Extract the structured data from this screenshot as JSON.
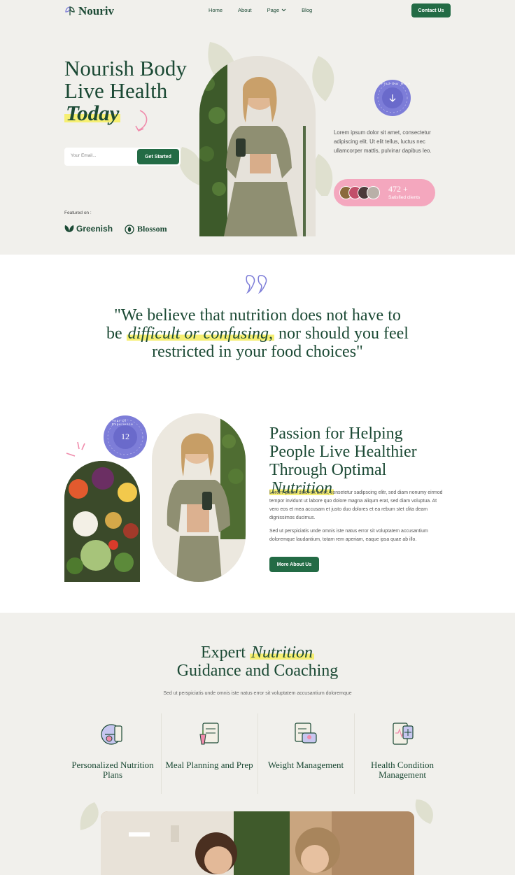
{
  "nav": {
    "brand": "Nouriv",
    "links": [
      "Home",
      "About",
      "Page",
      "Blog"
    ],
    "contact": "Contact Us"
  },
  "hero": {
    "title_line1": "Nourish Body",
    "title_line2": "Live Health",
    "title_line3": "Today",
    "email_placeholder": "Your Email...",
    "cta": "Get Started",
    "featured_label": "Featured on :",
    "brands": [
      "Greenish",
      "Blossom"
    ],
    "description": "Lorem ipsum dolor sit amet, consectetur adipiscing elit. Ut elit tellus, luctus nec ullamcorper mattis, pulvinar dapibus leo.",
    "badge_text": "Find Our More",
    "clients_count": "472 +",
    "clients_label": "Satisfied clients"
  },
  "quote": {
    "part1": "\"We believe that nutrition does not have to be",
    "highlight": "difficult or confusing,",
    "part2": "nor should you feel restricted in your food choices\""
  },
  "about": {
    "badge_number": "12",
    "badge_text": "Year Of Experience",
    "title_part1": "Passion for Helping People Live Healthier Through Optimal",
    "title_highlight": "Nutrition",
    "p1": "Lorem ipsum dolor sit amet, consetetur sadipscing elitr, sed diam nonumy eirmod tempor invidunt ut labore quo dolore magna aliqum erat, sed diam voluptua. At vero eos et mea accusam et justo duo dolores et ea rebum stet clita deam dignissimos ducimus.",
    "p2": "Sed ut perspiciatis unde omnis iste natus error sit voluptatem accusantium doloremque laudantium, totam rem aperiam, eaque ipsa quae ab illo.",
    "button": "More About Us"
  },
  "services": {
    "title_part1": "Expert",
    "title_highlight": "Nutrition",
    "title_part2": "Guidance and Coaching",
    "subtitle": "Sed ut perspiciatis unde omnis iste natus error sit voluptatem accusantium doloremque",
    "items": [
      {
        "label": "Personalized Nutrition Plans",
        "icon": "nutrition-plan-icon"
      },
      {
        "label": "Meal Planning and Prep",
        "icon": "meal-planning-icon"
      },
      {
        "label": "Weight Management",
        "icon": "weight-management-icon"
      },
      {
        "label": "Health Condition Management",
        "icon": "health-condition-icon"
      }
    ]
  },
  "colors": {
    "primary": "#236b45",
    "heading": "#1c4a35",
    "accent_purple": "#7d7dd8",
    "accent_pink": "#f4a7be",
    "highlight": "#f6ef72",
    "background": "#f1f0ec"
  }
}
